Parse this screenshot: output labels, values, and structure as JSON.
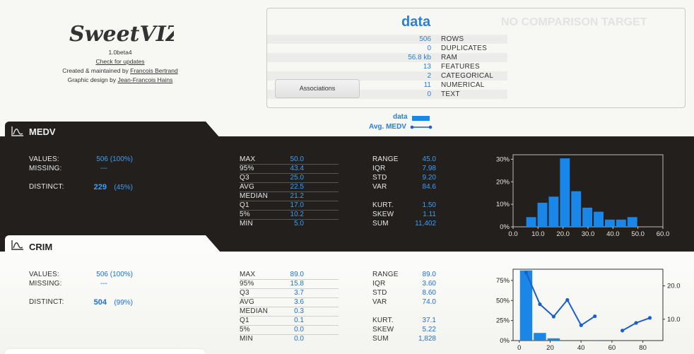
{
  "header": {
    "logo_text": "SweetVIZ",
    "version": "1.0beta4",
    "check_updates": "Check for updates",
    "created_by_prefix": "Created & maintained by ",
    "created_by_name": "Francois Bertrand",
    "design_prefix": "Graphic design by ",
    "design_name": "Jean-Francois Hains"
  },
  "summary": {
    "source_title": "data",
    "compare_title": "NO COMPARISON TARGET",
    "rows": [
      {
        "value": "506",
        "label": "ROWS"
      },
      {
        "value": "0",
        "label": "DUPLICATES"
      },
      {
        "value": "56.8 kb",
        "label": "RAM"
      },
      {
        "value": "13",
        "label": "FEATURES"
      },
      {
        "value": "2",
        "label": "CATEGORICAL"
      },
      {
        "value": "11",
        "label": "NUMERICAL"
      },
      {
        "value": "0",
        "label": "TEXT"
      }
    ],
    "associations_button": "Associations"
  },
  "legend": {
    "data_label": "data",
    "avg_label": "Avg. MEDV"
  },
  "colors": {
    "accent": "#2a7fd8",
    "bar": "#1a86e8",
    "dark_bg": "#221f1d"
  },
  "features": [
    {
      "name": "MEDV",
      "icon": "numeric-chart-icon",
      "values_label": "VALUES:",
      "values": "506 (100%)",
      "missing_label": "MISSING:",
      "missing": "---",
      "distinct_label": "DISTINCT:",
      "distinct": "229",
      "distinct_pct": "(45%)",
      "quantiles": [
        {
          "label": "MAX",
          "value": "50.0"
        },
        {
          "label": "95%",
          "value": "43.4"
        },
        {
          "label": "Q3",
          "value": "25.0"
        },
        {
          "label": "AVG",
          "value": "22.5"
        },
        {
          "label": "MEDIAN",
          "value": "21.2"
        },
        {
          "label": "Q1",
          "value": "17.0"
        },
        {
          "label": "5%",
          "value": "10.2"
        },
        {
          "label": "MIN",
          "value": "5.0"
        }
      ],
      "stats": [
        {
          "label": "RANGE",
          "value": "45.0"
        },
        {
          "label": "IQR",
          "value": "7.98"
        },
        {
          "label": "STD",
          "value": "9.20"
        },
        {
          "label": "VAR",
          "value": "84.6"
        }
      ],
      "stats2": [
        {
          "label": "KURT.",
          "value": "1.50"
        },
        {
          "label": "SKEW",
          "value": "1.11"
        },
        {
          "label": "SUM",
          "value": "11,402"
        }
      ]
    },
    {
      "name": "CRIM",
      "icon": "numeric-chart-icon",
      "values_label": "VALUES:",
      "values": "506 (100%)",
      "missing_label": "MISSING:",
      "missing": "---",
      "distinct_label": "DISTINCT:",
      "distinct": "504",
      "distinct_pct": "(99%)",
      "quantiles": [
        {
          "label": "MAX",
          "value": "89.0"
        },
        {
          "label": "95%",
          "value": "15.8"
        },
        {
          "label": "Q3",
          "value": "3.7"
        },
        {
          "label": "AVG",
          "value": "3.6"
        },
        {
          "label": "MEDIAN",
          "value": "0.3"
        },
        {
          "label": "Q1",
          "value": "0.1"
        },
        {
          "label": "5%",
          "value": "0.0"
        },
        {
          "label": "MIN",
          "value": "0.0"
        }
      ],
      "stats": [
        {
          "label": "RANGE",
          "value": "89.0"
        },
        {
          "label": "IQR",
          "value": "3.60"
        },
        {
          "label": "STD",
          "value": "8.60"
        },
        {
          "label": "VAR",
          "value": "74.0"
        }
      ],
      "stats2": [
        {
          "label": "KURT.",
          "value": "37.1"
        },
        {
          "label": "SKEW",
          "value": "5.22"
        },
        {
          "label": "SUM",
          "value": "1,828"
        }
      ]
    }
  ],
  "chart_data": [
    {
      "type": "bar",
      "feature": "MEDV",
      "x_ticks": [
        "0.0",
        "10.0",
        "20.0",
        "30.0",
        "40.0",
        "50.0",
        "60.0"
      ],
      "y_ticks": [
        "0%",
        "10%",
        "20%",
        "30%"
      ],
      "xlim": [
        0,
        60
      ],
      "ylim": [
        0,
        32
      ],
      "bins": [
        5,
        9.5,
        14,
        18.5,
        23,
        27.5,
        32,
        36.5,
        41,
        45.5,
        50
      ],
      "values": [
        4.3,
        10.7,
        13.4,
        30.4,
        15.8,
        8.5,
        6.7,
        3.2,
        3.2,
        4.3
      ]
    },
    {
      "type": "bar+line",
      "feature": "CRIM",
      "x_ticks": [
        "0",
        "20",
        "40",
        "60",
        "80"
      ],
      "y_ticks": [
        "0%",
        "25%",
        "50%",
        "75%"
      ],
      "y2_ticks": [
        "10.0",
        "20.0"
      ],
      "xlim": [
        -4,
        93
      ],
      "ylim": [
        0,
        89
      ],
      "y2lim": [
        3.6,
        25
      ],
      "bins": [
        0,
        8.9,
        17.8,
        26.7,
        35.6,
        44.5,
        53.4,
        62.3,
        71.2,
        80.1,
        89
      ],
      "values": [
        87.5,
        9.5,
        2.8,
        0,
        0,
        0.6,
        0,
        0,
        0,
        0
      ],
      "avg_medv": {
        "x": [
          4.45,
          13.35,
          22.25,
          31.15,
          40.05,
          48.95,
          66.75,
          75.65,
          84.55
        ],
        "y": [
          24,
          14.5,
          10.8,
          15.8,
          8.2,
          10.9,
          6.6,
          8.9,
          10.4
        ]
      }
    }
  ]
}
